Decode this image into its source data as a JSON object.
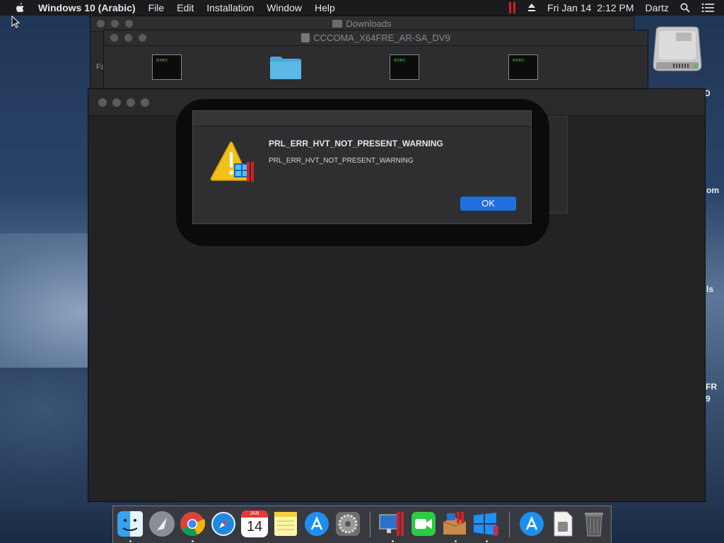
{
  "menubar": {
    "app_name": "Windows 10 (Arabic)",
    "menus": [
      "File",
      "Edit",
      "Installation",
      "Window",
      "Help"
    ],
    "date": "Fri Jan 14",
    "time": "2:12 PM",
    "user": "Dartz"
  },
  "windows": {
    "downloads_title": "Downloads",
    "downloads_sidebar_fragment": "Fa",
    "cccoma_title": "CCCOMA_X64FRE_AR-SA_DV9",
    "exec_label": "exec"
  },
  "desktop_fragments": [
    "D",
    "om",
    "ls",
    "FR",
    "9"
  ],
  "dialog": {
    "title": "PRL_ERR_HVT_NOT_PRESENT_WARNING",
    "message": "PRL_ERR_HVT_NOT_PRESENT_WARNING",
    "ok_label": "OK"
  },
  "dock": {
    "calendar_month": "JAN",
    "calendar_day": "14",
    "apps": [
      "Finder",
      "Launchpad",
      "Google Chrome",
      "Safari",
      "Calendar",
      "Notes",
      "App Store",
      "System Preferences",
      "Parallels Desktop",
      "FaceTime",
      "Parallels Installer",
      "Windows 10",
      "App Store Downloads",
      "Document",
      "Trash"
    ]
  },
  "colors": {
    "accent_button": "#1f6fe0",
    "parallels_red": "#d0202a",
    "warning_yellow": "#f2c21b"
  }
}
